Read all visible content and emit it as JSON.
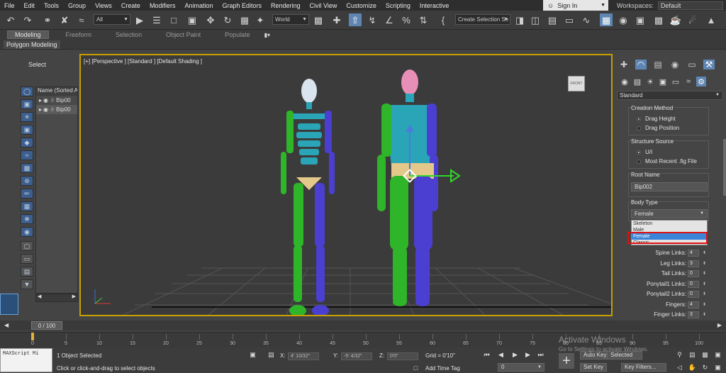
{
  "menu": [
    "File",
    "Edit",
    "Tools",
    "Group",
    "Views",
    "Create",
    "Modifiers",
    "Animation",
    "Graph Editors",
    "Rendering",
    "Civil View",
    "Customize",
    "Scripting",
    "Interactive"
  ],
  "account": {
    "sign_in": "Sign In",
    "workspaces_label": "Workspaces:",
    "workspace": "Default"
  },
  "toolbar": {
    "filter": "All",
    "ref_coord": "World",
    "selection_set": "Create Selection Se"
  },
  "ribbon": {
    "tabs": [
      "Modeling",
      "Freeform",
      "Selection",
      "Object Paint",
      "Populate"
    ],
    "active": "Modeling",
    "sub": "Polygon Modeling"
  },
  "scene": {
    "select_label": "Select",
    "column": "Name (Sorted A",
    "rows": [
      "Bip00",
      "Bip00"
    ]
  },
  "viewport": {
    "label": "[+] [Perspective ] [Standard ] [Default Shading ]",
    "viewcube": "FRONT"
  },
  "panel": {
    "category": "Standard",
    "creation_method": "Creation Method",
    "drag_height": "Drag Height",
    "drag_position": "Drag Position",
    "structure_source": "Structure Source",
    "ui": "U/I",
    "most_recent": "Most Recent .fig File",
    "root_name_label": "Root Name",
    "root_name": "Bip002",
    "body_type_label": "Body Type",
    "body_type": "Female",
    "body_options": [
      "Skeleton",
      "Male",
      "Female",
      "Classic"
    ],
    "spinners": [
      {
        "label": "Spine Links:",
        "value": "4"
      },
      {
        "label": "Leg Links:",
        "value": "3"
      },
      {
        "label": "Tail Links:",
        "value": "0"
      },
      {
        "label": "Ponytail1 Links:",
        "value": "0"
      },
      {
        "label": "Ponytail2 Links:",
        "value": "0"
      },
      {
        "label": "Fingers:",
        "value": "4"
      },
      {
        "label": "Finger Links:",
        "value": "3"
      }
    ]
  },
  "timeline": {
    "frame": "0 / 100",
    "ticks": [
      "0",
      "5",
      "10",
      "15",
      "20",
      "25",
      "30",
      "35",
      "40",
      "45",
      "50",
      "55",
      "60",
      "65",
      "70",
      "75",
      "80",
      "85",
      "90",
      "95",
      "100"
    ]
  },
  "status": {
    "maxscript": "MAXScript Mi",
    "objects": "1 Object Selected",
    "prompt": "Click or click-and-drag to select objects",
    "x_label": "X:",
    "x": "4' 10/32\"",
    "y_label": "Y:",
    "y": "-5' 4/32\"",
    "z_label": "Z:",
    "z": "0'0\"",
    "grid": "Grid = 0'10\"",
    "add_time_tag": "Add Time Tag",
    "auto_key": "Auto Key",
    "selected": "Selected",
    "set_key": "Set Key",
    "key_filters": "Key Filters...",
    "frame_field": "0"
  },
  "watermark": {
    "line1": "Activate Windows",
    "line2": "Go to Settings to activate Windows."
  },
  "colors": {
    "accent": "#5f86b3",
    "viewport_border": "#c8a000",
    "highlight": "#3c84d8",
    "red_box": "#e01010"
  }
}
